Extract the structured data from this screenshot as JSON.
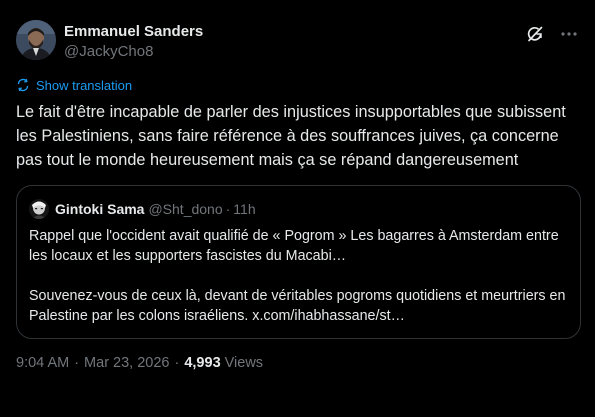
{
  "author": {
    "display_name": "Emmanuel Sanders",
    "handle": "@JackyCho8"
  },
  "header_icons": {
    "grok": "grok-icon",
    "more": "more-icon"
  },
  "translate": {
    "label": "Show translation",
    "icon": "translate-icon"
  },
  "tweet": {
    "text": "Le fait d'être incapable de parler des injustices insupportables que subissent les Palestiniens, sans faire référence à des souffrances juives, ça concerne pas tout le monde heureusement mais ça se répand dangereusement"
  },
  "quote": {
    "display_name": "Gintoki Sama",
    "handle": "@Sht_dono",
    "dot": "·",
    "time": "11h",
    "paragraph_1": "Rappel que l'occident avait qualifié de « Pogrom » Les bagarres à Amsterdam entre les locaux et les supporters fascistes du Macabi…",
    "paragraph_2": "Souvenez-vous de ceux là, devant de véritables pogroms quotidiens et meurtriers en Palestine par les colons israéliens. x.com/ihabhassane/st…"
  },
  "meta": {
    "time": "9:04 AM",
    "separator": "·",
    "date": "Mar 23, 2026",
    "separator_2": "·",
    "views_count": "4,993",
    "views_label": "Views"
  },
  "colors": {
    "background": "#000000",
    "text": "#e7e9ea",
    "secondary": "#71767b",
    "link": "#1d9bf0",
    "border": "#2f3336"
  }
}
